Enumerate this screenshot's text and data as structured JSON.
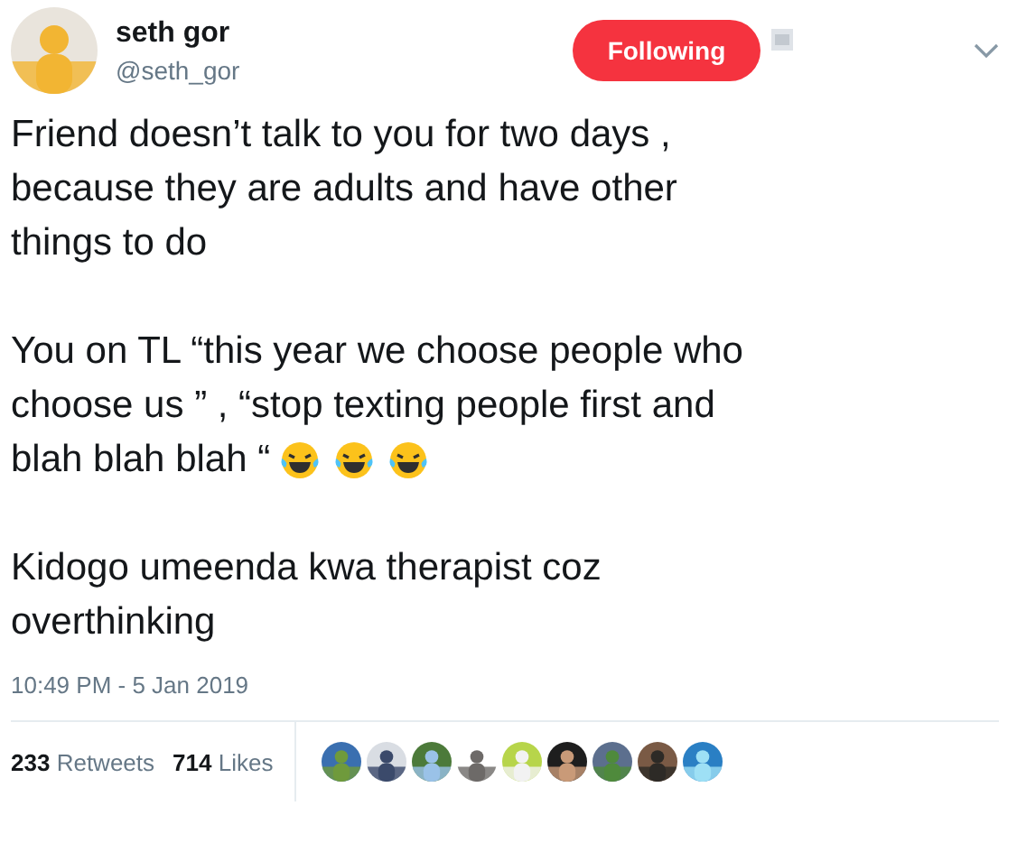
{
  "author": {
    "name": "seth gor",
    "handle": "@seth_gor"
  },
  "follow_button": {
    "label": "Following",
    "selected": true
  },
  "paragraphs": [
    {
      "lines": [
        "Friend doesn’t talk to you for two days ,",
        "because they are adults and have other",
        "things to do"
      ]
    },
    {
      "lines": [
        "You on TL “this year we choose people who",
        "choose us ” , “stop texting people first and",
        "blah blah blah “"
      ],
      "emojis": [
        {
          "kind": "laughing_tears"
        },
        {
          "kind": "laughing_tears"
        },
        {
          "kind": "laughing_tears"
        }
      ]
    },
    {
      "lines": [
        "Kidogo umeenda kwa therapist coz",
        "overthinking"
      ]
    }
  ],
  "timestamp": "10:49 PM - 5 Jan 2019",
  "stats": [
    {
      "count": "233",
      "label": "Retweets"
    },
    {
      "count": "714",
      "label": "Likes"
    }
  ]
}
